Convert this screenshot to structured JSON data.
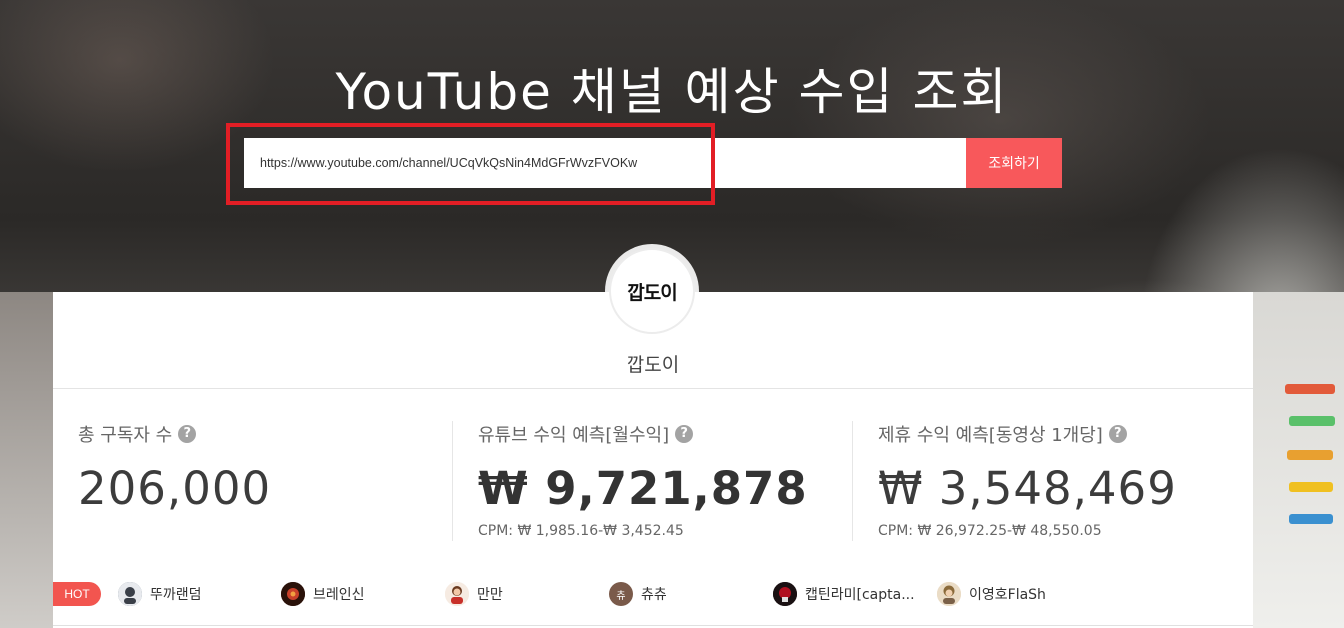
{
  "header": {
    "title": "YouTube 채널 예상 수입 조회"
  },
  "search": {
    "value": "https://www.youtube.com/channel/UCqVkQsNin4MdGFrWvzFVOKw",
    "button_label": "조회하기"
  },
  "channel": {
    "avatar_text": "깝도이",
    "name": "깝도이"
  },
  "stats": [
    {
      "label": "총 구독자 수",
      "value": "206,000",
      "help": "?"
    },
    {
      "label": "유튜브 수익 예측[월수익]",
      "value": "₩ 9,721,878",
      "cpm": "CPM: ₩ 1,985.16-₩ 3,452.45",
      "help": "?"
    },
    {
      "label": "제휴 수익 예측[동영상 1개당]",
      "value": "₩ 3,548,469",
      "cpm": "CPM: ₩ 26,972.25-₩ 48,550.05",
      "help": "?"
    }
  ],
  "hot": {
    "badge": "HOT",
    "items": [
      {
        "name": "뚜까랜덤",
        "color": "#5a6a7a"
      },
      {
        "name": "브레인신",
        "color": "#8a2a1a"
      },
      {
        "name": "만만",
        "color": "#c24a3a"
      },
      {
        "name": "츄츄",
        "color": "#7a5a4a",
        "thumb_text": "츄"
      },
      {
        "name": "캡틴라미[capta...",
        "color": "#b01020"
      },
      {
        "name": "이영호FlaSh",
        "color": "#8a6a3a"
      }
    ]
  },
  "colors": {
    "accent": "#f8585b",
    "highlight": "#e21e25"
  }
}
